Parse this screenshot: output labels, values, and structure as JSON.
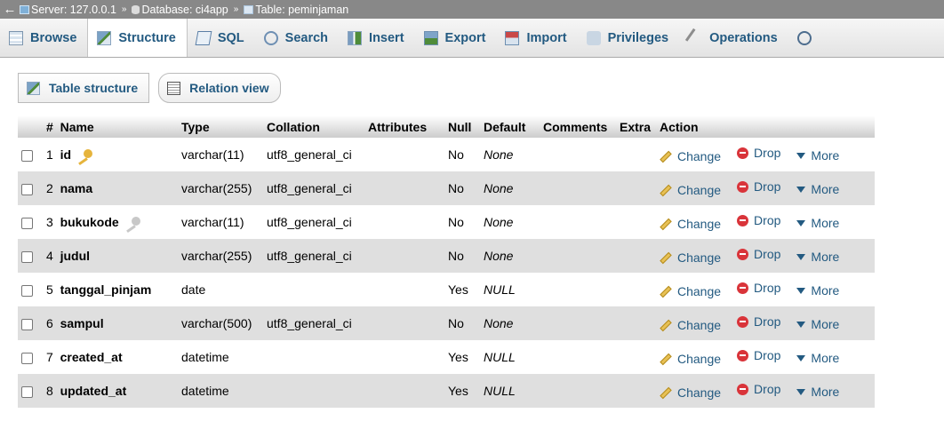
{
  "breadcrumb": {
    "back": "←",
    "server": "Server: 127.0.0.1",
    "database": "Database: ci4app",
    "table": "Table: peminjaman",
    "separator": "»"
  },
  "tabs": [
    {
      "label": "Browse",
      "icon": "browse-icon"
    },
    {
      "label": "Structure",
      "icon": "structure-icon",
      "active": true
    },
    {
      "label": "SQL",
      "icon": "sql-icon"
    },
    {
      "label": "Search",
      "icon": "search-icon"
    },
    {
      "label": "Insert",
      "icon": "insert-icon"
    },
    {
      "label": "Export",
      "icon": "export-icon"
    },
    {
      "label": "Import",
      "icon": "import-icon"
    },
    {
      "label": "Privileges",
      "icon": "privileges-icon"
    },
    {
      "label": "Operations",
      "icon": "operations-icon"
    }
  ],
  "subtabs": {
    "table_structure": "Table structure",
    "relation_view": "Relation view"
  },
  "table": {
    "headers": {
      "num": "#",
      "name": "Name",
      "type": "Type",
      "collation": "Collation",
      "attributes": "Attributes",
      "null": "Null",
      "default": "Default",
      "comments": "Comments",
      "extra": "Extra",
      "action": "Action"
    },
    "rows": [
      {
        "num": "1",
        "name": "id",
        "key": "primary",
        "type": "varchar(11)",
        "collation": "utf8_general_ci",
        "null": "No",
        "default": "None"
      },
      {
        "num": "2",
        "name": "nama",
        "key": "",
        "type": "varchar(255)",
        "collation": "utf8_general_ci",
        "null": "No",
        "default": "None"
      },
      {
        "num": "3",
        "name": "bukukode",
        "key": "index",
        "type": "varchar(11)",
        "collation": "utf8_general_ci",
        "null": "No",
        "default": "None"
      },
      {
        "num": "4",
        "name": "judul",
        "key": "",
        "type": "varchar(255)",
        "collation": "utf8_general_ci",
        "null": "No",
        "default": "None"
      },
      {
        "num": "5",
        "name": "tanggal_pinjam",
        "key": "",
        "type": "date",
        "collation": "",
        "null": "Yes",
        "default": "NULL"
      },
      {
        "num": "6",
        "name": "sampul",
        "key": "",
        "type": "varchar(500)",
        "collation": "utf8_general_ci",
        "null": "No",
        "default": "None"
      },
      {
        "num": "7",
        "name": "created_at",
        "key": "",
        "type": "datetime",
        "collation": "",
        "null": "Yes",
        "default": "NULL"
      },
      {
        "num": "8",
        "name": "updated_at",
        "key": "",
        "type": "datetime",
        "collation": "",
        "null": "Yes",
        "default": "NULL"
      }
    ],
    "actions": {
      "change": "Change",
      "drop": "Drop",
      "more": "More"
    }
  },
  "colors": {
    "link": "#235a81",
    "breadcrumb_bg": "#888888",
    "row_alt": "#dfdfdf",
    "drop_red": "#d9343a",
    "key_gold": "#e6b43c"
  }
}
